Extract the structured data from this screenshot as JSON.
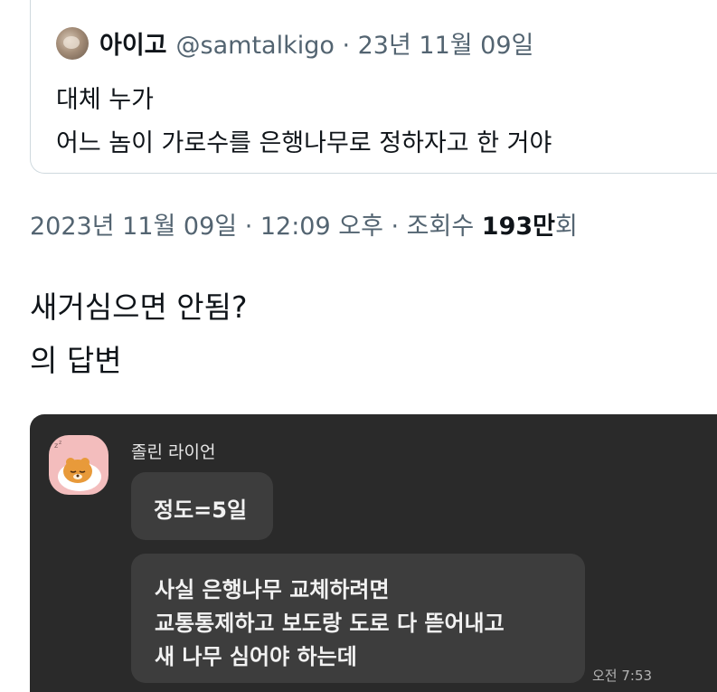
{
  "quoted_tweet": {
    "display_name": "아이고",
    "handle_and_date": "@samtalkigo · 23년 11월 09일",
    "lines": [
      "대체 누가",
      "어느 놈이 가로수를 은행나무로 정하자고 한 거야"
    ]
  },
  "meta": {
    "timestamp": "2023년 11월 09일 · 12:09 오후 · 조회수 ",
    "views_count": "193만",
    "views_suffix": "회"
  },
  "post_body": {
    "lines": [
      "새거심으면 안됨?",
      "의 답변"
    ]
  },
  "chat": {
    "sender_name": "졸린 라이언",
    "avatar_icon": "sleeping-ryan-lion-icon",
    "messages": [
      {
        "lines": [
          "정도=5일"
        ]
      },
      {
        "lines": [
          "사실 은행나무 교체하려면",
          "교통통제하고 보도랑 도로 다 뜯어내고",
          "새 나무 심어야 하는데"
        ]
      }
    ],
    "time": "오전 7:53"
  },
  "colors": {
    "chat_background": "#2a2a2a",
    "bubble": "#3d3d3d",
    "avatar_background": "#f3bdbd",
    "muted_text": "#536471"
  }
}
